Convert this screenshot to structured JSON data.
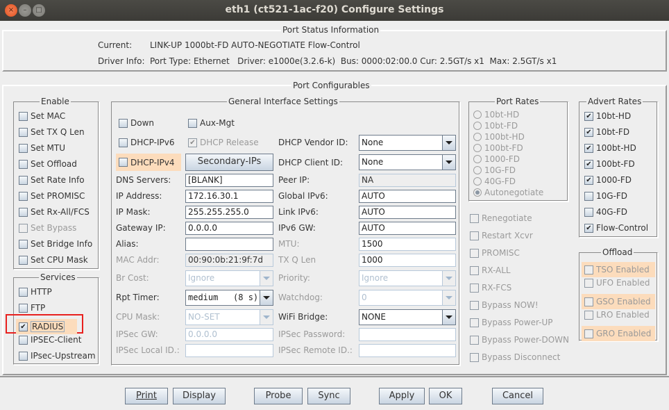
{
  "window": {
    "title": "eth1  (ct521-1ac-f20) Configure Settings",
    "controls": {
      "close": "×",
      "minimize": "–",
      "maximize": "□"
    }
  },
  "port_status": {
    "legend": "Port Status Information",
    "current_label": "Current:",
    "current_value": "LINK-UP 1000bt-FD AUTO-NEGOTIATE Flow-Control",
    "driver_label": "Driver Info:",
    "driver_value": "Port Type: Ethernet   Driver: e1000e(3.2.6-k)  Bus: 0000:02:00.0 Cur: 2.5GT/s x1  Max: 2.5GT/s x1"
  },
  "port_configurables": {
    "legend": "Port Configurables"
  },
  "enable": {
    "legend": "Enable",
    "items": [
      {
        "label": "Set MAC",
        "checked": false,
        "disabled": false
      },
      {
        "label": "Set TX Q Len",
        "checked": false,
        "disabled": false
      },
      {
        "label": "Set MTU",
        "checked": false,
        "disabled": false
      },
      {
        "label": "Set Offload",
        "checked": false,
        "disabled": false
      },
      {
        "label": "Set Rate Info",
        "checked": false,
        "disabled": false
      },
      {
        "label": "Set PROMISC",
        "checked": false,
        "disabled": false
      },
      {
        "label": "Set Rx-All/FCS",
        "checked": false,
        "disabled": false
      },
      {
        "label": "Set Bypass",
        "checked": false,
        "disabled": true
      },
      {
        "label": "Set Bridge Info",
        "checked": false,
        "disabled": false
      },
      {
        "label": "Set CPU Mask",
        "checked": false,
        "disabled": false
      }
    ]
  },
  "services": {
    "legend": "Services",
    "items": [
      {
        "label": "HTTP",
        "checked": false
      },
      {
        "label": "FTP",
        "checked": false
      },
      {
        "label": "RADIUS",
        "checked": true,
        "highlighted": true
      },
      {
        "label": "IPSEC-Client",
        "checked": false
      },
      {
        "label": "IPsec-Upstream",
        "checked": false
      }
    ]
  },
  "general": {
    "legend": "General Interface Settings",
    "down": {
      "label": "Down",
      "checked": false
    },
    "aux_mgt": {
      "label": "Aux-Mgt",
      "checked": false
    },
    "dhcp_ipv6": {
      "label": "DHCP-IPv6",
      "checked": false
    },
    "dhcp_release": {
      "label": "DHCP Release",
      "checked": true,
      "disabled": true
    },
    "dhcp_ipv4": {
      "label": "DHCP-IPv4",
      "checked": false
    },
    "secondary_ips_button": "Secondary-IPs",
    "dns_servers": {
      "label": "DNS Servers:",
      "value": "[BLANK]"
    },
    "ip_address": {
      "label": "IP Address:",
      "value": "172.16.30.1"
    },
    "ip_mask": {
      "label": "IP Mask:",
      "value": "255.255.255.0"
    },
    "gateway_ip": {
      "label": "Gateway IP:",
      "value": "0.0.0.0"
    },
    "alias": {
      "label": "Alias:",
      "value": ""
    },
    "mac_addr": {
      "label": "MAC Addr:",
      "value": "00:90:0b:21:9f:7d"
    },
    "br_cost": {
      "label": "Br Cost:",
      "value": "Ignore"
    },
    "rpt_timer": {
      "label": "Rpt Timer:",
      "value": "medium   (8 s)"
    },
    "cpu_mask": {
      "label": "CPU Mask:",
      "value": "NO-SET"
    },
    "ipsec_gw": {
      "label": "IPSec GW:",
      "value": "0.0.0.0"
    },
    "ipsec_local_id": {
      "label": "IPSec Local ID.:",
      "value": ""
    },
    "dhcp_vendor_id": {
      "label": "DHCP Vendor ID:",
      "value": "None"
    },
    "dhcp_client_id": {
      "label": "DHCP Client ID:",
      "value": "None"
    },
    "peer_ip": {
      "label": "Peer IP:",
      "value": "NA"
    },
    "global_ipv6": {
      "label": "Global IPv6:",
      "value": "AUTO"
    },
    "link_ipv6": {
      "label": "Link IPv6:",
      "value": "AUTO"
    },
    "ipv6_gw": {
      "label": "IPv6 GW:",
      "value": "AUTO"
    },
    "mtu": {
      "label": "MTU:",
      "value": "1500"
    },
    "tx_q_len": {
      "label": "TX Q Len",
      "value": "1000"
    },
    "priority": {
      "label": "Priority:",
      "value": "Ignore"
    },
    "watchdog": {
      "label": "Watchdog:",
      "value": "0"
    },
    "wifi_bridge": {
      "label": "WiFi Bridge:",
      "value": "NONE"
    },
    "ipsec_password": {
      "label": "IPSec Password:",
      "value": ""
    },
    "ipsec_remote_id": {
      "label": "IPSec Remote ID.:",
      "value": ""
    }
  },
  "port_rates": {
    "legend": "Port Rates",
    "options": [
      {
        "label": "10bt-HD",
        "selected": false
      },
      {
        "label": "10bt-FD",
        "selected": false
      },
      {
        "label": "100bt-HD",
        "selected": false
      },
      {
        "label": "100bt-FD",
        "selected": false
      },
      {
        "label": "1000-FD",
        "selected": false
      },
      {
        "label": "10G-FD",
        "selected": false
      },
      {
        "label": "40G-FD",
        "selected": false
      },
      {
        "label": "Autonegotiate",
        "selected": true
      }
    ]
  },
  "port_actions": [
    {
      "label": "Renegotiate",
      "checked": false
    },
    {
      "label": "Restart Xcvr",
      "checked": false
    },
    {
      "label": "PROMISC",
      "checked": false
    },
    {
      "label": "RX-ALL",
      "checked": false
    },
    {
      "label": "RX-FCS",
      "checked": false
    },
    {
      "label": "Bypass NOW!",
      "checked": false
    },
    {
      "label": "Bypass Power-UP",
      "checked": false
    },
    {
      "label": "Bypass Power-DOWN",
      "checked": false
    },
    {
      "label": "Bypass Disconnect",
      "checked": false
    }
  ],
  "advert_rates": {
    "legend": "Advert Rates",
    "items": [
      {
        "label": "10bt-HD",
        "checked": true
      },
      {
        "label": "10bt-FD",
        "checked": true
      },
      {
        "label": "100bt-HD",
        "checked": true
      },
      {
        "label": "100bt-FD",
        "checked": true
      },
      {
        "label": "1000-FD",
        "checked": true
      },
      {
        "label": "10G-FD",
        "checked": false
      },
      {
        "label": "40G-FD",
        "checked": false
      },
      {
        "label": "Flow-Control",
        "checked": true
      }
    ]
  },
  "offload": {
    "legend": "Offload",
    "items": [
      {
        "label": "TSO Enabled",
        "checked": false,
        "highlighted": true
      },
      {
        "label": "UFO Enabled",
        "checked": false,
        "highlighted": false
      },
      {
        "label": "GSO Enabled",
        "checked": false,
        "highlighted": true
      },
      {
        "label": "LRO Enabled",
        "checked": false,
        "highlighted": false
      },
      {
        "label": "GRO Enabled",
        "checked": false,
        "highlighted": true
      }
    ]
  },
  "buttons": {
    "print": "Print",
    "display": "Display",
    "probe": "Probe",
    "sync": "Sync",
    "apply": "Apply",
    "ok": "OK",
    "cancel": "Cancel"
  },
  "colors": {
    "highlight": "#fcdcbc",
    "annotation_box": "#e8201e",
    "titlebar": "#3c3b37",
    "close_button": "#e95420"
  }
}
